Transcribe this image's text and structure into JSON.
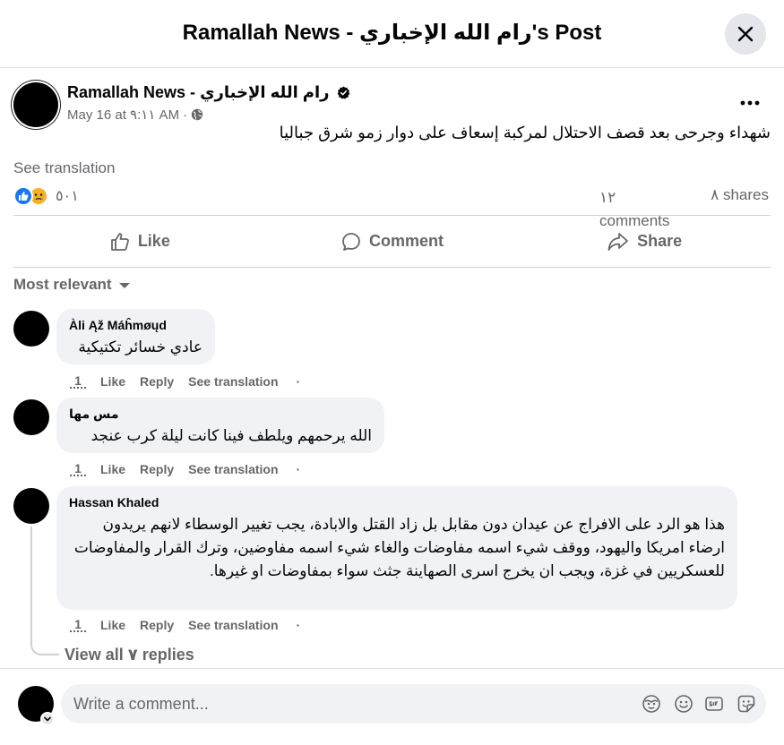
{
  "header": {
    "title": "Ramallah News - رام الله الإخباري's Post"
  },
  "post": {
    "page_name": "Ramallah News - رام الله الإخباري",
    "time": "May 16 at ٩:١١ AM",
    "time_separator": "·",
    "text": "شهداء وجرحى بعد قصف الاحتلال لمركبة إسعاف على دوار زمو شرق جباليا",
    "see_translation": "See translation",
    "reaction_count": "٥٠١",
    "comments_count": "١٢ comments",
    "shares_count": "٨ shares"
  },
  "actions": {
    "like": "Like",
    "comment": "Comment",
    "share": "Share"
  },
  "sort": {
    "label": "Most relevant"
  },
  "comments": [
    {
      "author": "Àli Ąž Máĥmøųd",
      "text": "عادي خسائر تكتيكية",
      "time": "1",
      "like": "Like",
      "reply": "Reply",
      "see_translation": "See translation",
      "dot": "·"
    },
    {
      "author": "مس مها",
      "text": "الله يرحمهم ويلطف فينا كانت ليلة كرب عنجد",
      "time": "1",
      "like": "Like",
      "reply": "Reply",
      "see_translation": "See translation",
      "dot": "·"
    },
    {
      "author": "Hassan Khaled",
      "text": "هذا هو الرد على الافراج عن عيدان دون مقابل بل زاد القتل والابادة، يجب تغيير الوسطاء لانهم يريدون ارضاء امريكا واليهود، ووقف شيء اسمه مفاوضات والغاء شيء اسمه مفاوضين، وترك القرار والمفاوضات للعسكريين في غزة، ويجب ان يخرج اسرى الصهاينة جثث سواء بمفاوضات او غيرها.",
      "time": "1",
      "like": "Like",
      "reply": "Reply",
      "see_translation": "See translation",
      "dot": "·"
    }
  ],
  "view_replies": "View all ٧ replies",
  "composer": {
    "placeholder": "Write a comment..."
  }
}
